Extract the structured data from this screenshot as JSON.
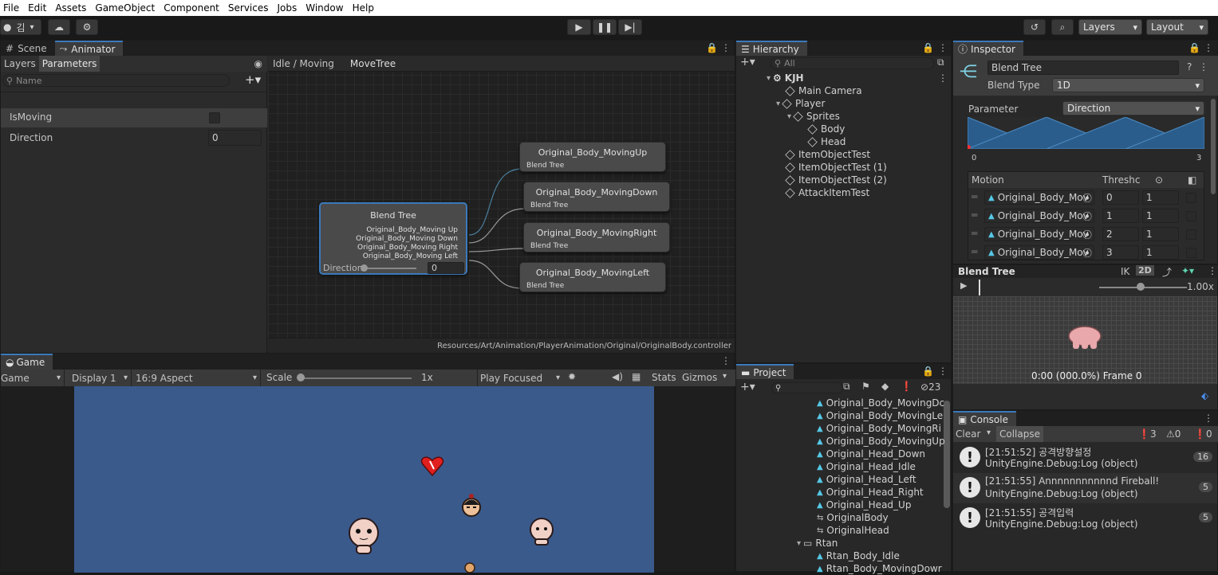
{
  "menu": [
    "File",
    "Edit",
    "Assets",
    "GameObject",
    "Component",
    "Services",
    "Jobs",
    "Window",
    "Help"
  ],
  "toolbar": {
    "account": "김",
    "layers": "Layers",
    "layout": "Layout"
  },
  "scene_tab": "Scene",
  "animator_tab": "Animator",
  "animator": {
    "layers_tab": "Layers",
    "parameters_tab": "Parameters",
    "name_placeholder": "Name",
    "params": [
      {
        "name": "IsMoving",
        "type": "bool"
      },
      {
        "name": "Direction",
        "value": "0"
      }
    ],
    "breadcrumb": [
      "Idle / Moving",
      "MoveTree"
    ],
    "blend_node": {
      "title": "Blend Tree",
      "outputs": [
        "Original_Body_Moving Up",
        "Original_Body_Moving Down",
        "Original_Body_Moving Right",
        "Original_Body_Moving Left"
      ],
      "param": "Direction",
      "value": "0"
    },
    "child_nodes": [
      {
        "title": "Original_Body_MovingUp",
        "sub": "Blend Tree"
      },
      {
        "title": "Original_Body_MovingDown",
        "sub": "Blend Tree"
      },
      {
        "title": "Original_Body_MovingRight",
        "sub": "Blend Tree"
      },
      {
        "title": "Original_Body_MovingLeft",
        "sub": "Blend Tree"
      }
    ],
    "path": "Resources/Art/Animation/PlayerAnimation/Original/OriginalBody.controller"
  },
  "game": {
    "tab": "Game",
    "mode": "Game",
    "display": "Display 1",
    "aspect": "16:9 Aspect",
    "scale_label": "Scale",
    "scale_value": "1x",
    "play_focused": "Play Focused",
    "stats": "Stats",
    "gizmos": "Gizmos",
    "bg_color": "#3a5a8c"
  },
  "hierarchy": {
    "tab": "Hierarchy",
    "search": "All",
    "items": [
      {
        "label": "KJH",
        "indent": 0,
        "scene": true
      },
      {
        "label": "Main Camera",
        "indent": 1
      },
      {
        "label": "Player",
        "indent": 1
      },
      {
        "label": "Sprites",
        "indent": 2
      },
      {
        "label": "Body",
        "indent": 3
      },
      {
        "label": "Head",
        "indent": 3
      },
      {
        "label": "ItemObjectTest",
        "indent": 1
      },
      {
        "label": "ItemObjectTest (1)",
        "indent": 1
      },
      {
        "label": "ItemObjectTest (2)",
        "indent": 1
      },
      {
        "label": "AttackItemTest",
        "indent": 1
      }
    ]
  },
  "inspector": {
    "tab": "Inspector",
    "name": "Blend Tree",
    "blend_type_label": "Blend Type",
    "blend_type": "1D",
    "parameter_label": "Parameter",
    "parameter": "Direction",
    "range_min": "0",
    "range_max": "3",
    "motion_header": "Motion",
    "threshold_header": "Threshc",
    "motions": [
      {
        "name": "Original_Body_Mov",
        "threshold": "0",
        "speed": "1"
      },
      {
        "name": "Original_Body_Mov",
        "threshold": "1",
        "speed": "1"
      },
      {
        "name": "Original_Body_Mov",
        "threshold": "2",
        "speed": "1"
      },
      {
        "name": "Original_Body_Mov",
        "threshold": "3",
        "speed": "1"
      }
    ],
    "preview_title": "Blend Tree",
    "ik": "IK",
    "twod": "2D",
    "speed": "1.00x",
    "time": "0:00 (000.0%) Frame 0"
  },
  "project": {
    "tab": "Project",
    "count": "23",
    "items": [
      {
        "label": "Original_Body_MovingDc",
        "type": "anim"
      },
      {
        "label": "Original_Body_MovingLe",
        "type": "anim"
      },
      {
        "label": "Original_Body_MovingRi",
        "type": "anim"
      },
      {
        "label": "Original_Body_MovingUp",
        "type": "anim"
      },
      {
        "label": "Original_Head_Down",
        "type": "anim"
      },
      {
        "label": "Original_Head_Idle",
        "type": "anim"
      },
      {
        "label": "Original_Head_Left",
        "type": "anim"
      },
      {
        "label": "Original_Head_Right",
        "type": "anim"
      },
      {
        "label": "Original_Head_Up",
        "type": "anim"
      },
      {
        "label": "OriginalBody",
        "type": "controller"
      },
      {
        "label": "OriginalHead",
        "type": "controller"
      },
      {
        "label": "Rtan",
        "type": "folder"
      },
      {
        "label": "Rtan_Body_Idle",
        "type": "anim"
      },
      {
        "label": "Rtan_Body_MovingDowr",
        "type": "anim"
      }
    ]
  },
  "console": {
    "tab": "Console",
    "clear": "Clear",
    "collapse": "Collapse",
    "log_count": "3",
    "warn_count": "0",
    "err_count": "0",
    "entries": [
      {
        "line1": "[21:51:52] 공격방향설정",
        "line2": "UnityEngine.Debug:Log (object)",
        "count": "16"
      },
      {
        "line1": "[21:51:55] Annnnnnnnnnnd Fireball!",
        "line2": "UnityEngine.Debug:Log (object)",
        "count": "5"
      },
      {
        "line1": "[21:51:55] 공격입력",
        "line2": "UnityEngine.Debug:Log (object)",
        "count": "5"
      }
    ]
  }
}
